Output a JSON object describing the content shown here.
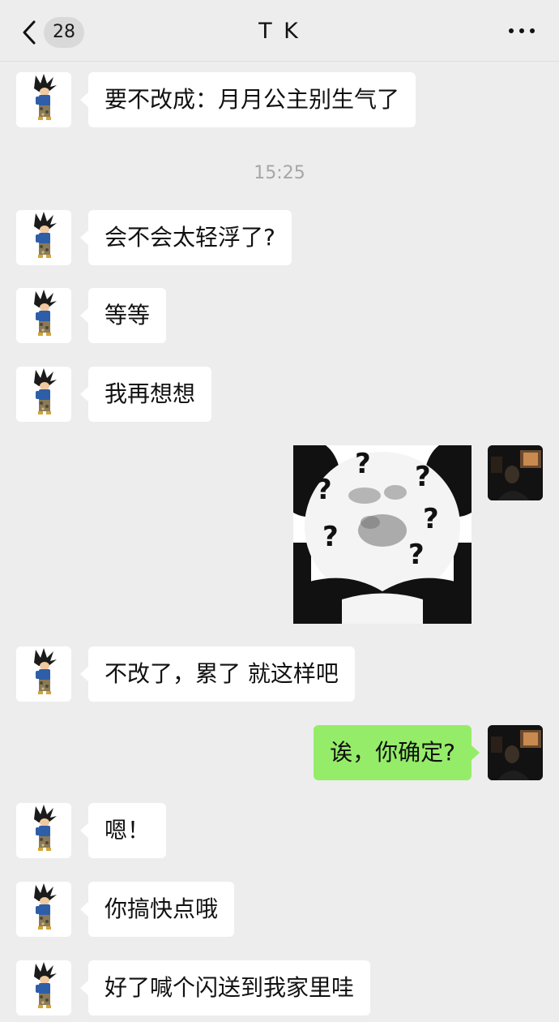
{
  "header": {
    "back_icon": "chevron-left-icon",
    "unread_count": "28",
    "title": "T K",
    "more_icon": "more-dots-icon"
  },
  "timestamps": [
    "15:25"
  ],
  "messages": [
    {
      "side": "left",
      "type": "text",
      "text": "要不改成：月月公主别生气了"
    },
    {
      "side": "left",
      "type": "text",
      "text": "会不会太轻浮了?"
    },
    {
      "side": "left",
      "type": "text",
      "text": "等等"
    },
    {
      "side": "left",
      "type": "text",
      "text": "我再想想"
    },
    {
      "side": "right",
      "type": "sticker",
      "sticker": "panda-question-marks-sticker"
    },
    {
      "side": "left",
      "type": "text",
      "text": "不改了，累了 就这样吧"
    },
    {
      "side": "right",
      "type": "text",
      "text": "诶，你确定?"
    },
    {
      "side": "left",
      "type": "text",
      "text": "嗯！"
    },
    {
      "side": "left",
      "type": "text",
      "text": "你搞快点哦"
    },
    {
      "side": "left",
      "type": "text",
      "text": "好了喊个闪送到我家里哇"
    }
  ],
  "colors": {
    "background": "#ededed",
    "incoming_bubble": "#ffffff",
    "outgoing_bubble": "#95ec69",
    "timestamp": "#a6a6a6"
  }
}
